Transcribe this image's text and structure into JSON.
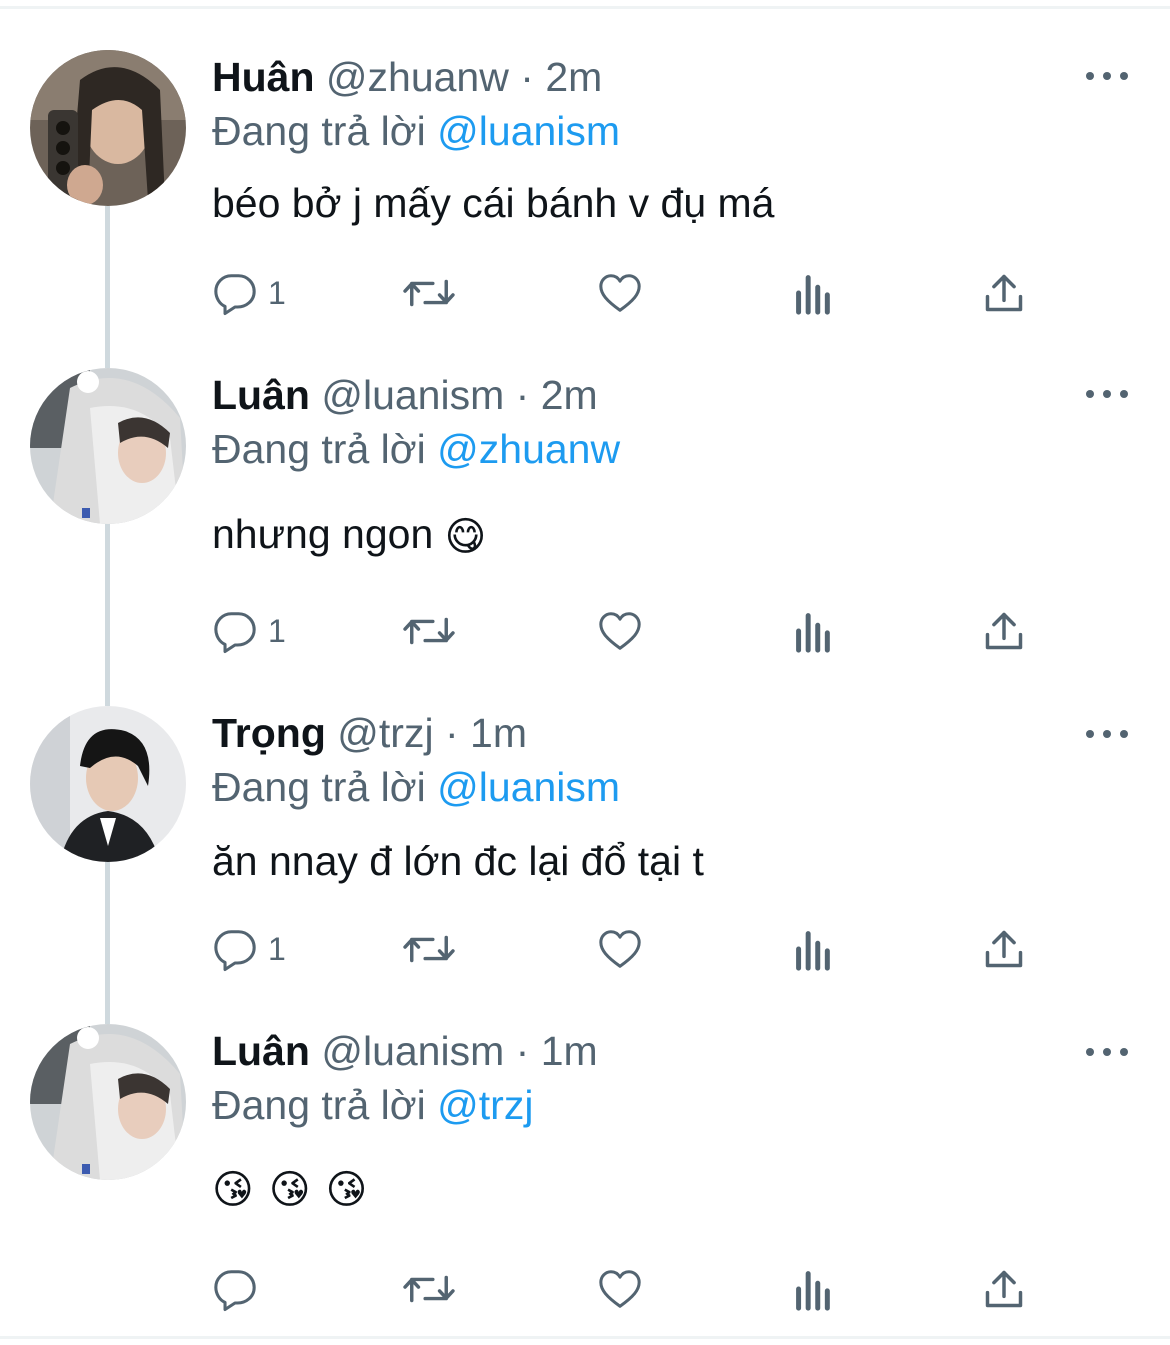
{
  "tweets": [
    {
      "name": "Huân",
      "handle": "@zhuanw",
      "dot": "·",
      "time": "2m",
      "reply_prefix": "Đang trả lời",
      "reply_to": "@luanism",
      "text": "béo bở j mấy cái bánh v đụ má",
      "reply_count": "1"
    },
    {
      "name": "Luân",
      "handle": "@luanism",
      "dot": "·",
      "time": "2m",
      "reply_prefix": "Đang trả lời",
      "reply_to": "@zhuanw",
      "text": "nhưng ngon",
      "emoji": "😋",
      "reply_count": "1"
    },
    {
      "name": "Trọng",
      "handle": "@trzj",
      "dot": "·",
      "time": "1m",
      "reply_prefix": "Đang trả lời",
      "reply_to": "@luanism",
      "text": "ăn nnay đ lớn đc lại đổ tại t",
      "reply_count": "1"
    },
    {
      "name": "Luân",
      "handle": "@luanism",
      "dot": "·",
      "time": "1m",
      "reply_prefix": "Đang trả lời",
      "reply_to": "@trzj",
      "emoji_text": "😘 😘 😘",
      "reply_count": ""
    }
  ],
  "icons": {
    "reply": "reply-icon",
    "retweet": "retweet-icon",
    "like": "heart-icon",
    "views": "views-icon",
    "share": "share-icon",
    "more": "more-icon"
  },
  "colors": {
    "text_primary": "#0f1419",
    "text_secondary": "#536471",
    "mention": "#1d9bf0",
    "thread_line": "#cfd9de",
    "divider": "#eff3f4"
  }
}
